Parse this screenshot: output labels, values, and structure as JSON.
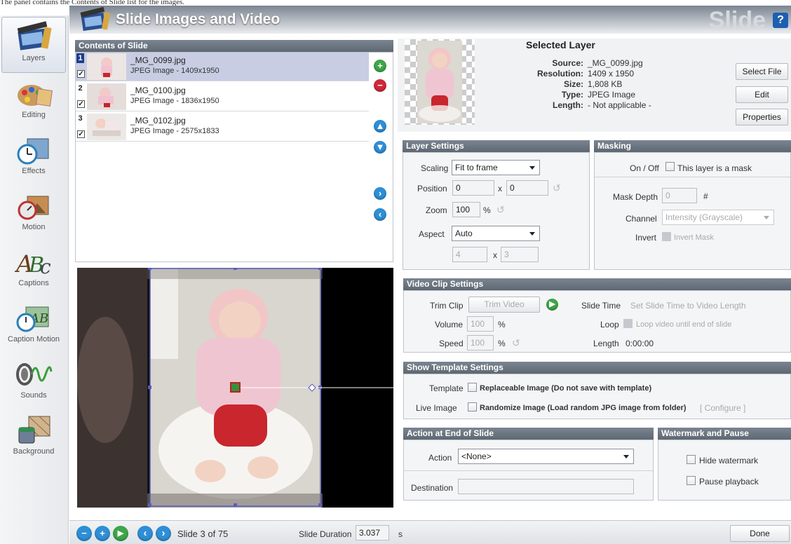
{
  "caption": "The panel contains the Contents of Slide list for the images.",
  "sidebar": {
    "items": [
      {
        "label": "Layers"
      },
      {
        "label": "Editing"
      },
      {
        "label": "Effects"
      },
      {
        "label": "Motion"
      },
      {
        "label": "Captions"
      },
      {
        "label": "Caption Motion"
      },
      {
        "label": "Sounds"
      },
      {
        "label": "Background"
      }
    ]
  },
  "header": {
    "title": "Slide Images and Video",
    "watermark": "Slide",
    "help": "?"
  },
  "contents": {
    "title": "Contents of Slide",
    "rows": [
      {
        "num": "1",
        "name": "_MG_0099.jpg",
        "type": "JPEG Image - 1409x1950",
        "checked": "✓"
      },
      {
        "num": "2",
        "name": "_MG_0100.jpg",
        "type": "JPEG Image - 1836x1950",
        "checked": "✓"
      },
      {
        "num": "3",
        "name": "_MG_0102.jpg",
        "type": "JPEG Image - 2575x1833",
        "checked": "✓"
      }
    ]
  },
  "selected_layer": {
    "title": "Selected Layer",
    "source_label": "Source:",
    "source": "_MG_0099.jpg",
    "resolution_label": "Resolution:",
    "resolution": "1409 x 1950",
    "size_label": "Size:",
    "size": "1,808 KB",
    "type_label": "Type:",
    "type": "JPEG Image",
    "length_label": "Length:",
    "length": "- Not applicable -",
    "select_file": "Select File",
    "edit": "Edit",
    "properties": "Properties"
  },
  "layer_settings": {
    "title": "Layer Settings",
    "scaling_label": "Scaling",
    "scaling": "Fit to frame",
    "position_label": "Position",
    "pos_x": "0",
    "pos_y": "0",
    "x": "x",
    "zoom_label": "Zoom",
    "zoom": "100",
    "percent": "%",
    "aspect_label": "Aspect",
    "aspect": "Auto",
    "aspect_w": "4",
    "aspect_h": "3"
  },
  "masking": {
    "title": "Masking",
    "onoff_label": "On / Off",
    "mask_cb": "This layer is a mask",
    "depth_label": "Mask Depth",
    "depth": "0",
    "hash": "#",
    "channel_label": "Channel",
    "channel": "Intensity (Grayscale)",
    "invert_label": "Invert",
    "invert_cb": "Invert Mask"
  },
  "video": {
    "title": "Video Clip Settings",
    "trim_label": "Trim Clip",
    "trim_btn": "Trim Video",
    "slide_time_label": "Slide Time",
    "slide_time": "Set Slide Time to Video Length",
    "volume_label": "Volume",
    "volume": "100",
    "percent": "%",
    "loop_label": "Loop",
    "loop_cb": "Loop video until end of slide",
    "speed_label": "Speed",
    "speed": "100",
    "length_label": "Length",
    "length": "0:00:00"
  },
  "template": {
    "title": "Show Template Settings",
    "template_label": "Template",
    "template_cb": "Replaceable Image (Do not save with template)",
    "live_label": "Live Image",
    "live_cb": "Randomize Image (Load random JPG image from folder)",
    "configure": "[ Configure ]"
  },
  "action": {
    "title": "Action at End of Slide",
    "action_label": "Action",
    "action": "<None>",
    "destination_label": "Destination",
    "destination": ""
  },
  "watermark": {
    "title": "Watermark and Pause",
    "hide": "Hide watermark",
    "pause": "Pause playback"
  },
  "bottom": {
    "slide_info": "Slide 3 of 75",
    "duration_label": "Slide Duration",
    "duration": "3.037",
    "unit": "s",
    "done": "Done"
  }
}
